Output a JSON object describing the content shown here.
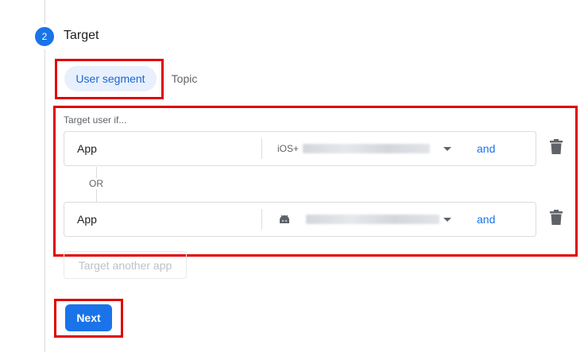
{
  "step": {
    "number": "2",
    "title": "Target"
  },
  "tabs": {
    "user_segment": "User segment",
    "topic": "Topic"
  },
  "targeting": {
    "hint": "Target user if...",
    "or_label": "OR",
    "rows": [
      {
        "field": "App",
        "platform": "iOS+",
        "connector": "and"
      },
      {
        "field": "App",
        "platform": "android",
        "connector": "and"
      }
    ]
  },
  "actions": {
    "target_another_app": "Target another app",
    "next": "Next"
  },
  "colors": {
    "accent": "#1a73e8",
    "highlight": "#e00000",
    "chip_bg": "#e8f0fe"
  },
  "icons": [
    "delete-icon",
    "android-icon",
    "dropdown-caret-icon"
  ]
}
